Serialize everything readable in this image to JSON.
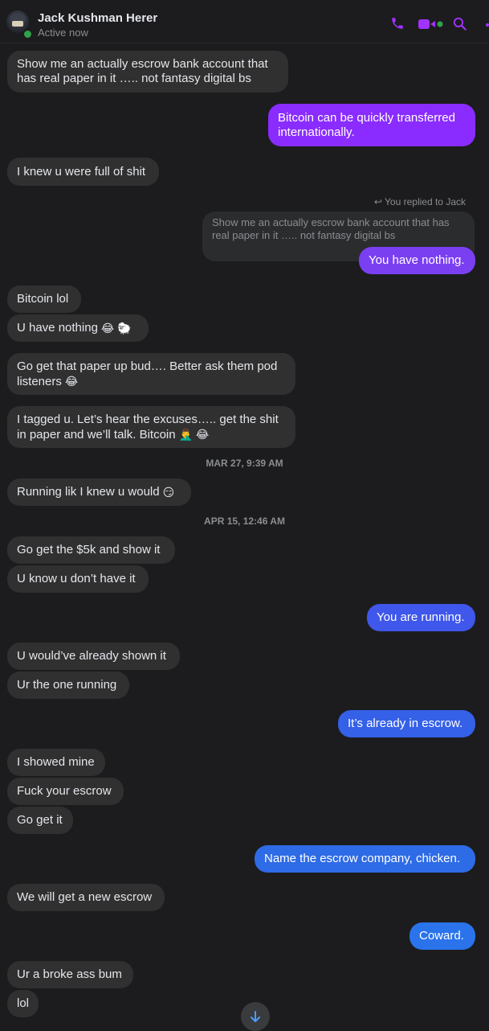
{
  "header": {
    "contact_name": "Jack Kushman Herer",
    "status": "Active now"
  },
  "colors": {
    "accent": "#a033ff",
    "outgoing_purple": "#8a2cff",
    "outgoing_blue": "#2e6be6",
    "incoming": "#303030",
    "online": "#31a24c"
  },
  "messages": [
    {
      "text": "Show me an actually escrow bank account that has real paper in it ….. not fantasy digital bs"
    },
    {
      "text": "Bitcoin can be quickly transferred internationally."
    },
    {
      "text": "I knew u were full of shit"
    },
    {
      "reply_hint": "You replied to Jack",
      "quoted": "Show me an actually escrow bank account that has real paper in it ….. not fantasy digital bs",
      "text": "You have nothing."
    },
    {
      "text": "Bitcoin lol"
    },
    {
      "text": "U have nothing",
      "emoji": "😂 🐑"
    },
    {
      "text": "Go get that paper up bud…. Better ask them pod listeners",
      "emoji": "😂"
    },
    {
      "text": "I tagged u. Let’s hear the excuses….. get the shit in paper and we’ll talk. Bitcoin",
      "emoji": "🤦‍♂️ 😂"
    },
    {
      "text": "Running lik I knew u would",
      "emoji": "😏"
    },
    {
      "text": "Go get the $5k and show it"
    },
    {
      "text": "U know u don’t have it"
    },
    {
      "text": "You are running."
    },
    {
      "text": "U would’ve already shown it"
    },
    {
      "text": "Ur the one running"
    },
    {
      "text": "It’s already in escrow."
    },
    {
      "text": "I showed mine"
    },
    {
      "text": "Fuck your escrow"
    },
    {
      "text": "Go get it"
    },
    {
      "text": "Name the escrow company, chicken."
    },
    {
      "text": "We will get a new escrow"
    },
    {
      "text": "Coward."
    },
    {
      "text": "Ur a broke ass bum"
    },
    {
      "text": "lol"
    }
  ],
  "timestamps": [
    "MAR 27, 9:39 AM",
    "APR 15, 12:46 AM"
  ]
}
